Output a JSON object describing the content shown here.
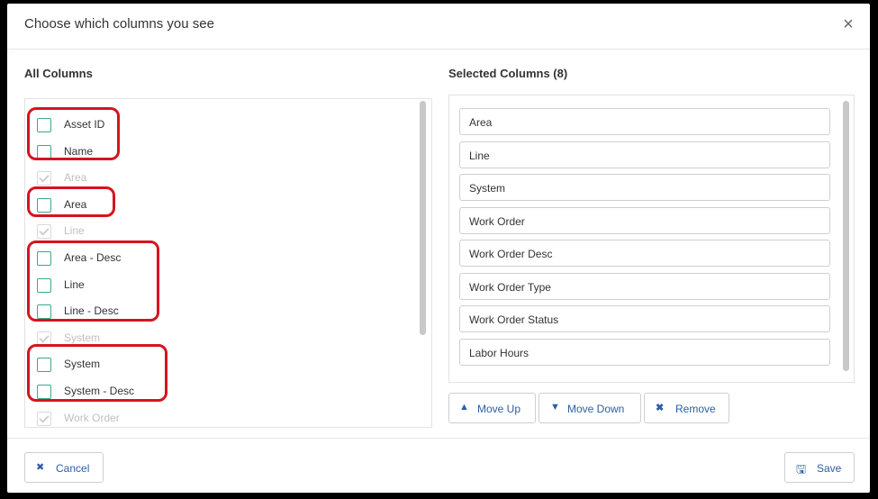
{
  "dialog": {
    "title": "Choose which columns you see",
    "close_glyph": "×",
    "left_title": "All Columns",
    "right_title": "Selected Columns (8)"
  },
  "all_columns": [
    {
      "label": "Asset ID",
      "checked": false
    },
    {
      "label": "Name",
      "checked": false
    },
    {
      "label": "Area",
      "checked": true
    },
    {
      "label": "Area",
      "checked": false
    },
    {
      "label": "Line",
      "checked": true
    },
    {
      "label": "Area - Desc",
      "checked": false
    },
    {
      "label": "Line",
      "checked": false
    },
    {
      "label": "Line - Desc",
      "checked": false
    },
    {
      "label": "System",
      "checked": true
    },
    {
      "label": "System",
      "checked": false
    },
    {
      "label": "System - Desc",
      "checked": false
    },
    {
      "label": "Work Order",
      "checked": true
    }
  ],
  "selected_columns": [
    "Area",
    "Line",
    "System",
    "Work Order",
    "Work Order Desc",
    "Work Order Type",
    "Work Order Status",
    "Labor Hours"
  ],
  "actions": {
    "move_up": "Move Up",
    "move_down": "Move Down",
    "remove": "Remove"
  },
  "footer": {
    "cancel": "Cancel",
    "save": "Save"
  },
  "icons": {
    "move_up": "caret-up-icon",
    "move_down": "caret-down-icon",
    "remove": "x-icon",
    "cancel": "x-icon",
    "save": "floppy-disk-icon"
  },
  "colors": {
    "checkbox": "#3aaa8c",
    "highlight": "#d6141e",
    "action_text": "#2c5fa3"
  }
}
